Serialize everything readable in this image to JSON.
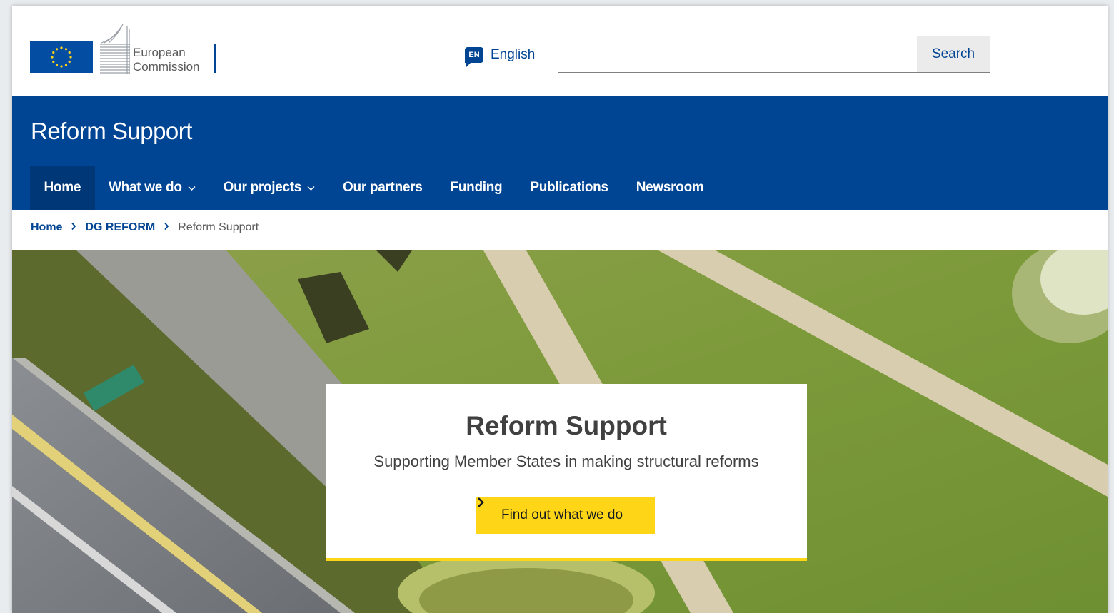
{
  "header": {
    "org_line1": "European",
    "org_line2": "Commission",
    "language_code": "EN",
    "language_label": "English",
    "search_value": "",
    "search_button": "Search"
  },
  "banner": {
    "site_name": "Reform Support"
  },
  "nav": {
    "items": [
      {
        "label": "Home",
        "active": true,
        "dropdown": false
      },
      {
        "label": "What we do",
        "active": false,
        "dropdown": true
      },
      {
        "label": "Our projects",
        "active": false,
        "dropdown": true
      },
      {
        "label": "Our partners",
        "active": false,
        "dropdown": false
      },
      {
        "label": "Funding",
        "active": false,
        "dropdown": false
      },
      {
        "label": "Publications",
        "active": false,
        "dropdown": false
      },
      {
        "label": "Newsroom",
        "active": false,
        "dropdown": false
      }
    ],
    "dropdown_icon": "chevron-down-icon"
  },
  "breadcrumb": {
    "items": [
      "Home",
      "DG REFORM"
    ],
    "current": "Reform Support",
    "separator_icon": "chevron-right-icon"
  },
  "hero": {
    "title": "Reform Support",
    "subtitle": "Supporting Member States in making structural reforms",
    "cta_label": "Find out what we do",
    "cta_icon": "chevron-right-icon"
  },
  "colors": {
    "ec_blue": "#004494",
    "nav_active": "#003776",
    "accent_yellow": "#ffd617",
    "text_dark": "#404040"
  }
}
